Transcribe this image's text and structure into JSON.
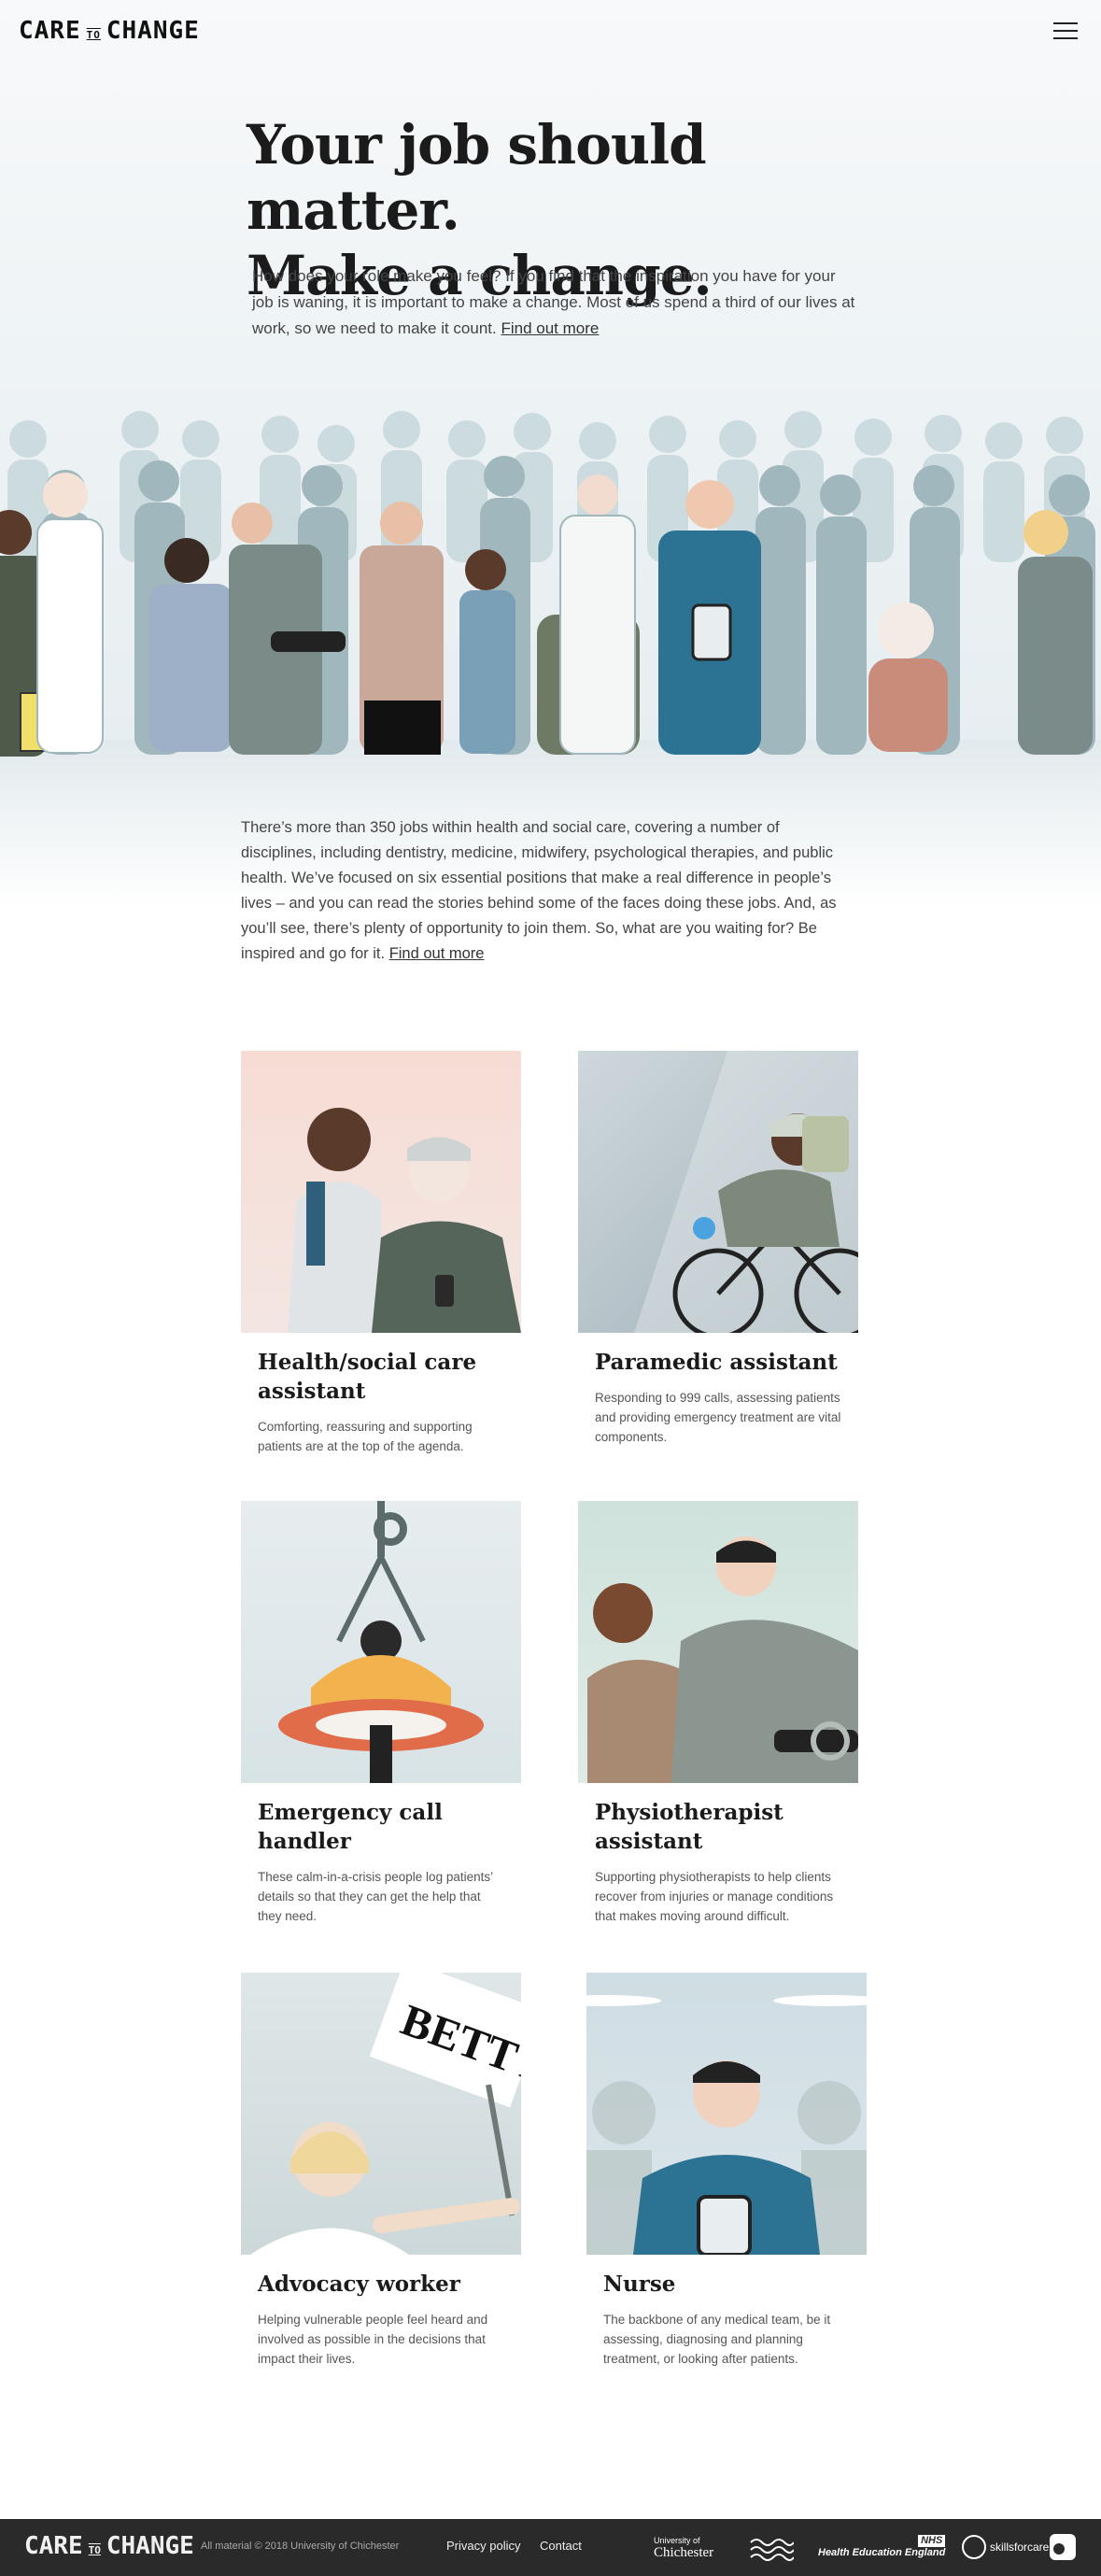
{
  "header": {
    "logo_left": "CARE",
    "logo_to": "TO",
    "logo_right": "CHANGE",
    "menu_icon": "hamburger-menu-icon"
  },
  "hero": {
    "title_line1": "Your job should matter.",
    "title_line2": "Make a change.",
    "text": "How does your role make you feel? If you find that the inspiration you have for your job is waning, it is important to make a change. Most of us spend a third of our lives at work, so we need to make it count.",
    "link": "Find out more"
  },
  "intro": {
    "text": "There’s more than 350 jobs within health and social care, covering a number of disciplines, including dentistry, medicine, midwifery, psychological therapies, and public health. We’ve focused on six essential positions that make a real difference in people’s lives – and you can read the stories behind some of the faces doing these jobs. And, as you’ll see, there’s plenty of opportunity to join them. So, what are you waiting for? Be inspired and go for it.",
    "link": "Find out more"
  },
  "cards": [
    {
      "title": "Health/social care assistant",
      "text": "Comforting, reassuring and supporting patients are at the top of the agenda."
    },
    {
      "title": "Paramedic assistant",
      "text": "Responding to 999 calls, assessing patients and providing emergency treatment are vital components."
    },
    {
      "title": "Emergency call handler",
      "text": "These calm-in-a-crisis people log patients’ details so that they can get the help that they need."
    },
    {
      "title": "Physiotherapist assistant",
      "text": "Supporting physiotherapists to help clients recover from injuries or manage conditions that makes moving around difficult."
    },
    {
      "title": "Advocacy worker",
      "text": "Helping vulnerable people feel heard and involved as possible in the decisions that impact their lives."
    },
    {
      "title": "Nurse",
      "text": "The backbone of any medical team, be it assessing, diagnosing and planning treatment, or looking after patients."
    }
  ],
  "sign_text": "BETTY",
  "footer": {
    "logo_left": "CARE",
    "logo_to": "TO",
    "logo_right": "CHANGE",
    "copyright": "All material  © 2018 University of Chichester",
    "privacy": "Privacy policy",
    "contact": "Contact",
    "partners": {
      "uni_small": "University of",
      "uni": "Chichester",
      "nhs": "NHS",
      "hee": "Health Education England",
      "sfc": "skillsforcare"
    }
  },
  "colors": {
    "heading": "#1b1b1b",
    "body": "#444444",
    "footer_bg": "#2a2a2a",
    "teal": "#3a7a9a",
    "crowd_tint": "#9fb7bd"
  }
}
